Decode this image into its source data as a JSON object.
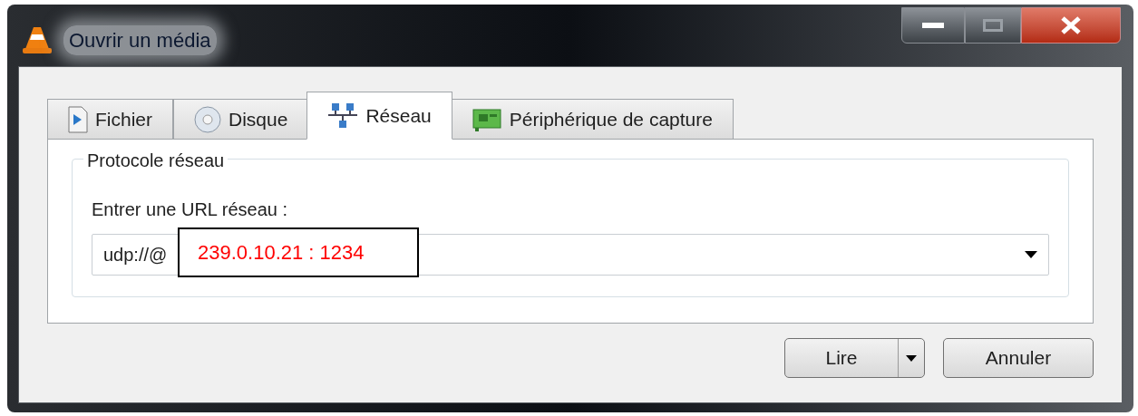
{
  "window": {
    "title": "Ouvrir un média"
  },
  "tabs": [
    {
      "label": "Fichier",
      "kind": "file",
      "selected": false
    },
    {
      "label": "Disque",
      "kind": "disc",
      "selected": false
    },
    {
      "label": "Réseau",
      "kind": "network",
      "selected": true
    },
    {
      "label": "Périphérique de capture",
      "kind": "capture",
      "selected": false
    }
  ],
  "group": {
    "title": "Protocole réseau",
    "field_label": "Entrer une URL réseau :",
    "url_value": "udp://@"
  },
  "annotation": "239.0.10.21 : 1234",
  "buttons": [
    {
      "label": "Lire",
      "kind": "split"
    },
    {
      "label": "Annuler",
      "kind": "plain"
    }
  ]
}
